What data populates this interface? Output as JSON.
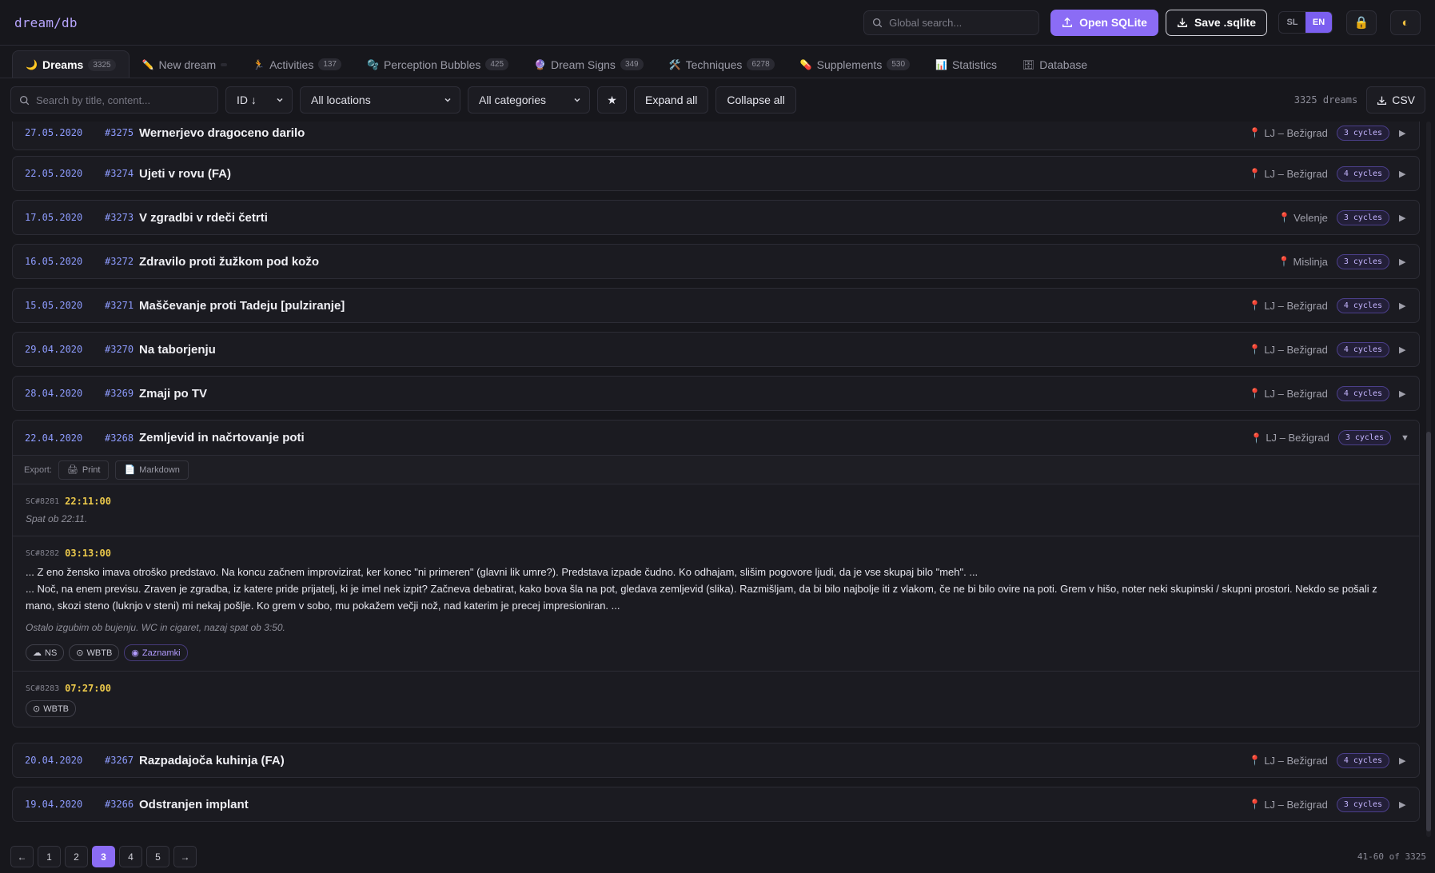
{
  "header": {
    "logo": "dream/db",
    "search_placeholder": "Global search...",
    "open_label": "Open SQLite",
    "save_label": "Save .sqlite",
    "lang_sl": "SL",
    "lang_en": "EN",
    "lock_icon": "🔒",
    "theme_icon": "◐"
  },
  "tabs": [
    {
      "label": "Dreams",
      "count": "3325",
      "icon": "🌙"
    },
    {
      "label": "New dream",
      "count": "",
      "icon": "✏️"
    },
    {
      "label": "Activities",
      "count": "137",
      "icon": "🏃"
    },
    {
      "label": "Perception Bubbles",
      "count": "425",
      "icon": "🫧"
    },
    {
      "label": "Dream Signs",
      "count": "349",
      "icon": "🔮"
    },
    {
      "label": "Techniques",
      "count": "6278",
      "icon": "🛠️"
    },
    {
      "label": "Supplements",
      "count": "530",
      "icon": "💊"
    },
    {
      "label": "Statistics",
      "count": "",
      "icon": "📊"
    },
    {
      "label": "Database",
      "count": "",
      "icon": "🗄"
    }
  ],
  "filters": {
    "search_placeholder": "Search by title, content...",
    "sort": "ID ↓",
    "location": "All locations",
    "category": "All categories",
    "star": "★",
    "expand": "Expand all",
    "collapse": "Collapse all",
    "count": "3325 dreams",
    "csv": "CSV"
  },
  "dreams_before": [
    {
      "date": "27.05.2020",
      "id": "#3275",
      "title": "Wernerjevo dragoceno darilo",
      "location": "LJ – Bežigrad",
      "cycles": "3 cycles"
    },
    {
      "date": "22.05.2020",
      "id": "#3274",
      "title": "Ujeti v rovu (FA)",
      "location": "LJ – Bežigrad",
      "cycles": "4 cycles"
    },
    {
      "date": "17.05.2020",
      "id": "#3273",
      "title": "V zgradbi v rdeči četrti",
      "location": "Velenje",
      "cycles": "3 cycles"
    },
    {
      "date": "16.05.2020",
      "id": "#3272",
      "title": "Zdravilo proti žužkom pod kožo",
      "location": "Mislinja",
      "cycles": "3 cycles"
    },
    {
      "date": "15.05.2020",
      "id": "#3271",
      "title": "Maščevanje proti Tadeju [pulziranje]",
      "location": "LJ – Bežigrad",
      "cycles": "4 cycles"
    },
    {
      "date": "29.04.2020",
      "id": "#3270",
      "title": "Na taborjenju",
      "location": "LJ – Bežigrad",
      "cycles": "4 cycles"
    },
    {
      "date": "28.04.2020",
      "id": "#3269",
      "title": "Zmaji po TV",
      "location": "LJ – Bežigrad",
      "cycles": "4 cycles"
    }
  ],
  "expanded": {
    "date": "22.04.2020",
    "id": "#3268",
    "title": "Zemljevid in načrtovanje poti",
    "location": "LJ – Bežigrad",
    "cycles": "3 cycles",
    "export_label": "Export:",
    "print_label": "Print",
    "markdown_label": "Markdown",
    "cycle1": {
      "id": "SC#8281",
      "time": "22:11:00",
      "note": "Spat ob 22:11."
    },
    "cycle2": {
      "id": "SC#8282",
      "time": "03:13:00",
      "line1": "... Z eno žensko imava otroško predstavo. Na koncu začnem improvizirat, ker konec \"ni primeren\" (glavni lik umre?). Predstava izpade čudno. Ko odhajam, slišim pogovore ljudi, da je vse skupaj bilo \"meh\". ...",
      "line2": "... Noč, na enem previsu. Zraven je zgradba, iz katere pride prijatelj, ki je imel nek izpit? Začneva debatirat, kako bova šla na pot, gledava zemljevid (slika). Razmišljam, da bi bilo najbolje iti z vlakom, če ne bi bilo ovire na poti. Grem v hišo, noter neki skupinski / skupni prostori. Nekdo se pošali z mano, skozi steno (luknjo v steni) mi nekaj pošlje. Ko grem v sobo, mu pokažem večji nož, nad katerim je precej impresioniran. ...",
      "note": "Ostalo izgubim ob bujenju. WC in cigaret, nazaj spat ob 3:50.",
      "tags": [
        "NS",
        "WBTB",
        "Zaznamki"
      ]
    },
    "cycle3": {
      "id": "SC#8283",
      "time": "07:27:00",
      "tags": [
        "WBTB"
      ]
    }
  },
  "dreams_after": [
    {
      "date": "20.04.2020",
      "id": "#3267",
      "title": "Razpadajoča kuhinja (FA)",
      "location": "LJ – Bežigrad",
      "cycles": "4 cycles"
    },
    {
      "date": "19.04.2020",
      "id": "#3266",
      "title": "Odstranjen implant",
      "location": "LJ – Bežigrad",
      "cycles": "3 cycles"
    }
  ],
  "pagination": {
    "prev": "←",
    "pages": [
      "1",
      "2",
      "3",
      "4",
      "5"
    ],
    "current": "3",
    "next": "→",
    "range": "41-60 of 3325"
  },
  "colors": {
    "accent": "#8b6cf5",
    "date": "#8e9cff",
    "time": "#ecc94b",
    "pin": "#e5485c"
  }
}
